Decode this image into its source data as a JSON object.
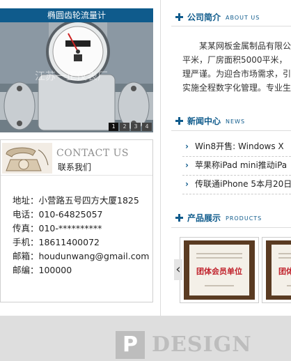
{
  "banner": {
    "title": "椭圆齿轮流量计",
    "watermark": "江苏一正仪表厂",
    "pages": [
      "1",
      "2",
      "3",
      "4"
    ]
  },
  "contact": {
    "heading_en": "CONTACT US",
    "heading_cn": "联系我们",
    "lines": [
      "地址：小营路五号四方大厦1825",
      "电话：010-64825057",
      "传真：010-**********",
      "手机：18611400072",
      "邮箱：houdunwang@gmail.com",
      "邮编：100000"
    ]
  },
  "about": {
    "title_cn": "公司简介",
    "title_en": "ABOUT US",
    "lines": [
      "某某网板金属制品有限公",
      "平米，厂房面积5000平米，",
      "理严谨。为迎合市场需求，引",
      "实施全程数字化管理。专业生"
    ]
  },
  "news": {
    "title_cn": "新闻中心",
    "title_en": "NEWS",
    "items": [
      "Win8开售: Windows X",
      "苹果称iPad mini推动iPa",
      "传联通iPhone 5本月20日"
    ]
  },
  "products": {
    "title_cn": "产品展示",
    "title_en": "PRODUCTS",
    "arrow": "‹",
    "items": [
      {
        "title": "团体会员单位"
      },
      {
        "title": "团体会员单位"
      }
    ]
  },
  "footer": {
    "logo_letter": "P",
    "logo_text": "DESIGN"
  },
  "colors": {
    "accent": "#0f5b8c",
    "footer_bg": "#dedede"
  }
}
